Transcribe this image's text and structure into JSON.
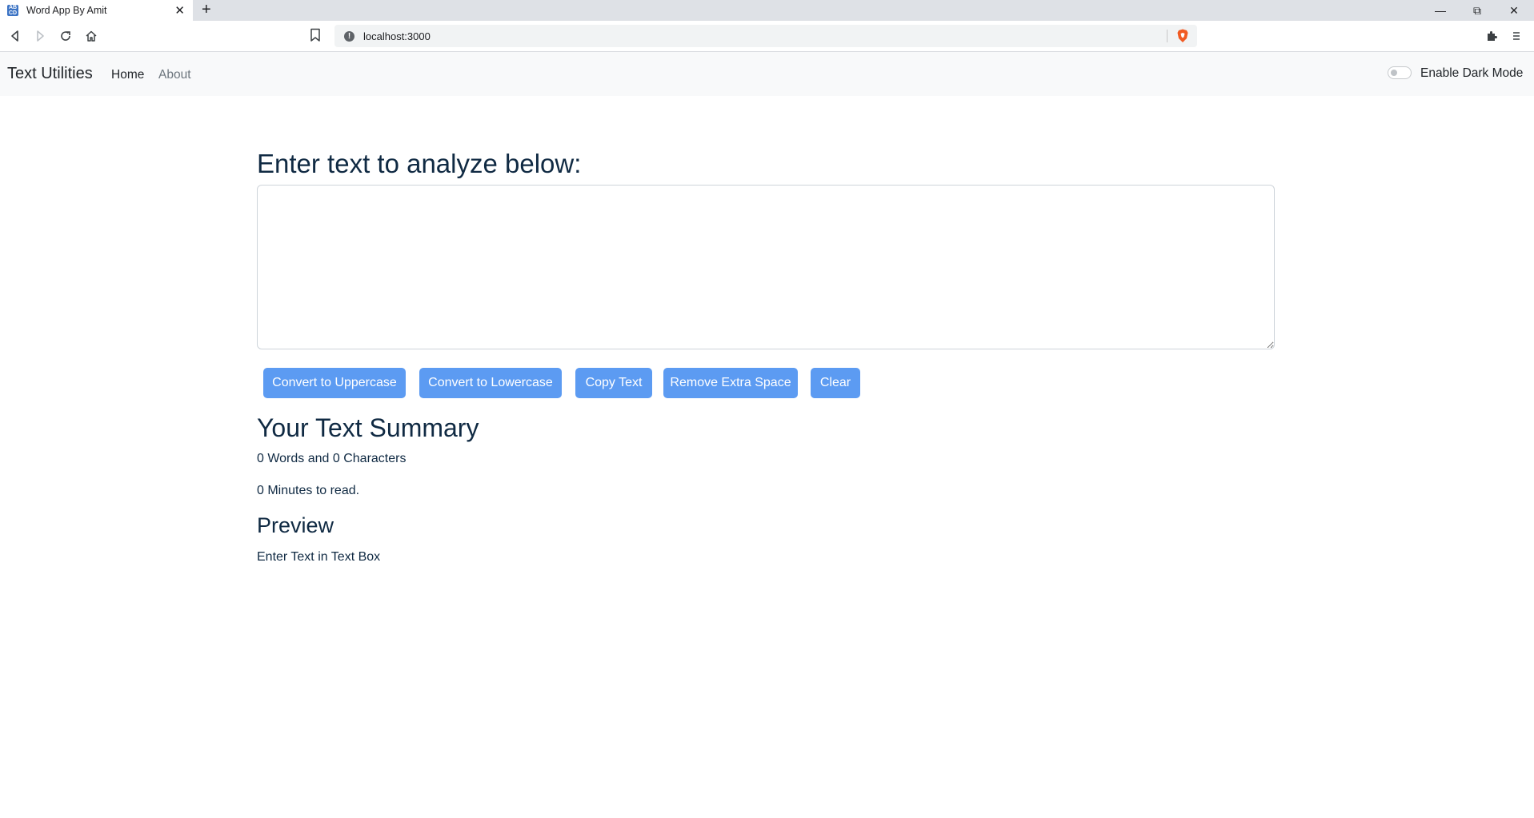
{
  "browser": {
    "tab_title": "Word App By Amit",
    "url": "localhost:3000"
  },
  "navbar": {
    "brand": "Text Utilities",
    "links": [
      "Home",
      "About"
    ],
    "dark_mode_label": "Enable Dark Mode",
    "dark_mode_enabled": false
  },
  "main": {
    "heading": "Enter text to analyze below:",
    "textarea_value": "",
    "buttons": [
      "Convert to Uppercase",
      "Convert to Lowercase",
      "Copy Text",
      "Remove Extra Space",
      "Clear"
    ],
    "summary_title": "Your Text Summary",
    "words_chars": "0 Words and 0 Characters",
    "read_time": "0 Minutes to read.",
    "preview_title": "Preview",
    "preview_text": "Enter Text in Text Box"
  },
  "colors": {
    "button_bg": "#5c9bf2",
    "heading_color": "#102a43",
    "navbar_bg": "#f8f9fa"
  }
}
